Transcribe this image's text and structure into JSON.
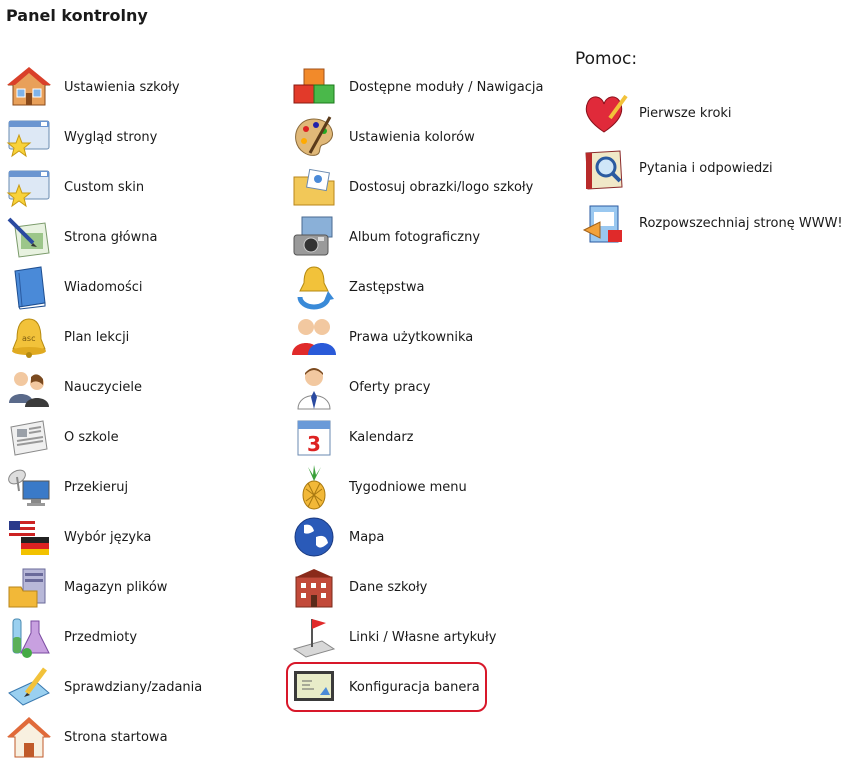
{
  "page": {
    "title": "Panel kontrolny"
  },
  "help": {
    "title": "Pomoc:",
    "items": [
      {
        "label": "Pierwsze kroki",
        "icon": "heart-pencil-icon"
      },
      {
        "label": "Pytania i odpowiedzi",
        "icon": "book-magnifier-icon"
      },
      {
        "label": "Rozpowszechniaj stronę WWW!",
        "icon": "share-page-icon"
      }
    ]
  },
  "column1": [
    {
      "label": "Ustawienia szkoły",
      "icon": "house-icon"
    },
    {
      "label": "Wygląd strony",
      "icon": "window-star-icon"
    },
    {
      "label": "Custom skin",
      "icon": "window-star-icon"
    },
    {
      "label": "Strona główna",
      "icon": "pen-paper-icon"
    },
    {
      "label": "Wiadomości",
      "icon": "blue-book-icon"
    },
    {
      "label": "Plan lekcji",
      "icon": "bell-icon"
    },
    {
      "label": "Nauczyciele",
      "icon": "people-icon"
    },
    {
      "label": "O szkole",
      "icon": "newspaper-icon"
    },
    {
      "label": "Przekieruj",
      "icon": "satellite-monitor-icon"
    },
    {
      "label": "Wybór języka",
      "icon": "flags-icon"
    },
    {
      "label": "Magazyn plików",
      "icon": "server-folder-icon"
    },
    {
      "label": "Przedmioty",
      "icon": "lab-flasks-icon"
    },
    {
      "label": "Sprawdziany/zadania",
      "icon": "pencil-paper-icon"
    },
    {
      "label": "Strona startowa",
      "icon": "home-icon"
    }
  ],
  "column2": [
    {
      "label": "Dostępne moduły / Nawigacja",
      "icon": "cubes-icon"
    },
    {
      "label": "Ustawienia kolorów",
      "icon": "palette-icon"
    },
    {
      "label": "Dostosuj obrazki/logo szkoły",
      "icon": "image-folder-icon"
    },
    {
      "label": "Album fotograficzny",
      "icon": "camera-photo-icon"
    },
    {
      "label": "Zastępstwa",
      "icon": "bell-arrows-icon"
    },
    {
      "label": "Prawa użytkownika",
      "icon": "users-icon"
    },
    {
      "label": "Oferty pracy",
      "icon": "businessman-icon"
    },
    {
      "label": "Kalendarz",
      "icon": "calendar-icon"
    },
    {
      "label": "Tygodniowe menu",
      "icon": "pineapple-icon"
    },
    {
      "label": "Mapa",
      "icon": "globe-icon"
    },
    {
      "label": "Dane szkoły",
      "icon": "building-icon"
    },
    {
      "label": "Linki / Własne artykuły",
      "icon": "flag-paper-icon"
    },
    {
      "label": "Konfiguracja banera",
      "icon": "banner-icon"
    }
  ]
}
